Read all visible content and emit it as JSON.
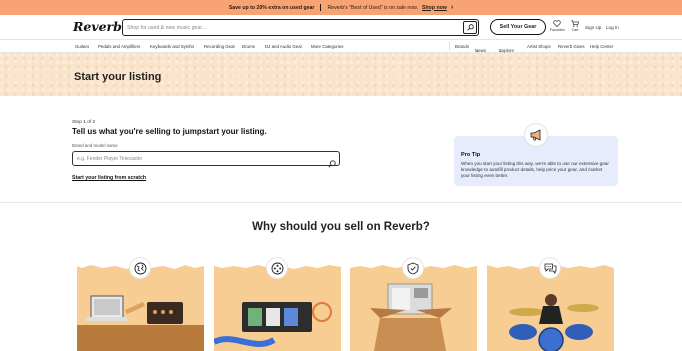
{
  "promo": {
    "text_bold": "Save up to 20% extra on used gear",
    "text_mid": "Reverb's \"Best of Used\" is on sale now.",
    "link": "Shop now"
  },
  "header": {
    "logo": "Reverb",
    "search_placeholder": "Shop for used & new music gear...",
    "sell_button": "Sell Your Gear",
    "favorites": "Favorites",
    "cart": "Cart",
    "sign_up": "Sign Up",
    "log_in": "Log In"
  },
  "nav": {
    "left": [
      "Guitars",
      "Pedals and Amplifiers",
      "Keyboards and Synths",
      "Recording Gear",
      "Drums",
      "DJ and Audio Gear",
      "More Categories"
    ],
    "right": [
      "Brands",
      "News",
      "Explore",
      "Artist Shops",
      "Reverb Gives",
      "Help Center"
    ]
  },
  "hero": {
    "title": "Start your listing"
  },
  "form": {
    "step": "Step 1 of 2",
    "question": "Tell us what you're selling to jumpstart your listing.",
    "field_label": "Brand and model name",
    "field_placeholder": "e.g. Fender Player Telecaster",
    "scratch_link": "Start your listing from scratch"
  },
  "tip": {
    "title": "Pro Tip",
    "body": "When you start your listing this way, we're able to use our extensive gear knowledge to autofill product details, help price your gear, and market your listing even better."
  },
  "why": {
    "title": "Why should you sell on Reverb?"
  },
  "cards": [
    {
      "icon": "globe-icon"
    },
    {
      "icon": "community-icon"
    },
    {
      "icon": "shield-check-icon"
    },
    {
      "icon": "chat-bubbles-icon"
    }
  ],
  "colors": {
    "promo": "#f8a373",
    "hero": "#fbe4cc",
    "tip": "#e6ecfb",
    "card": "#f7cd93"
  }
}
